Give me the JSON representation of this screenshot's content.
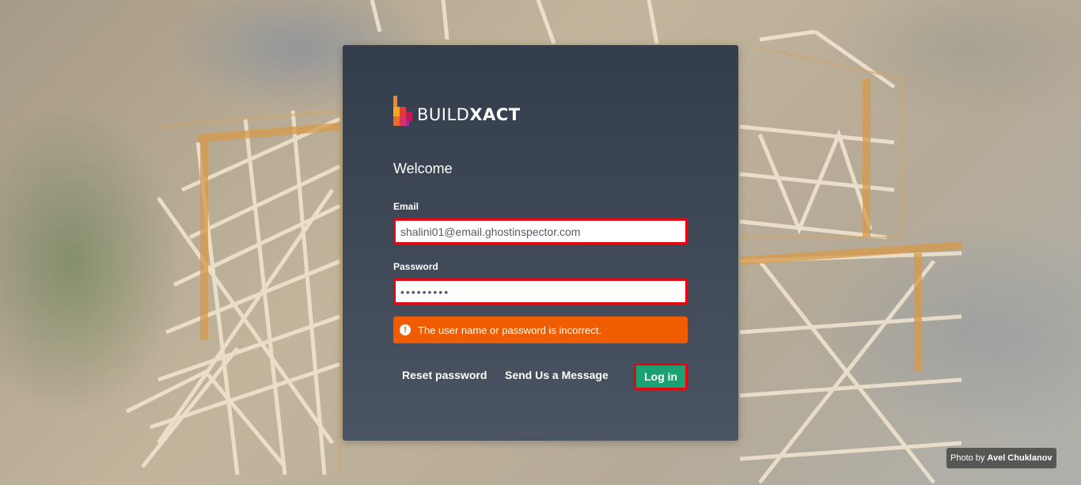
{
  "brand": {
    "name_light": "BUILD",
    "name_bold": "XACT",
    "colors": {
      "orange": "#f28a1e",
      "red": "#e23a3a",
      "magenta": "#c2185b"
    }
  },
  "form": {
    "heading": "Welcome",
    "email_label": "Email",
    "email_value": "shalini01@email.ghostinspector.com",
    "password_label": "Password",
    "password_value": "•••••••••",
    "error_icon": "!",
    "error_message": "The user name or password is incorrect.",
    "reset_password_label": "Reset password",
    "send_message_label": "Send Us a Message",
    "login_label": "Log in"
  },
  "credit": {
    "prefix": "Photo by",
    "author": "Avel Chuklanov"
  },
  "colors": {
    "card_bg": "#343d4b",
    "error_bg": "#ef5d00",
    "login_bg": "#1aa272",
    "highlight_border": "#e30613"
  }
}
